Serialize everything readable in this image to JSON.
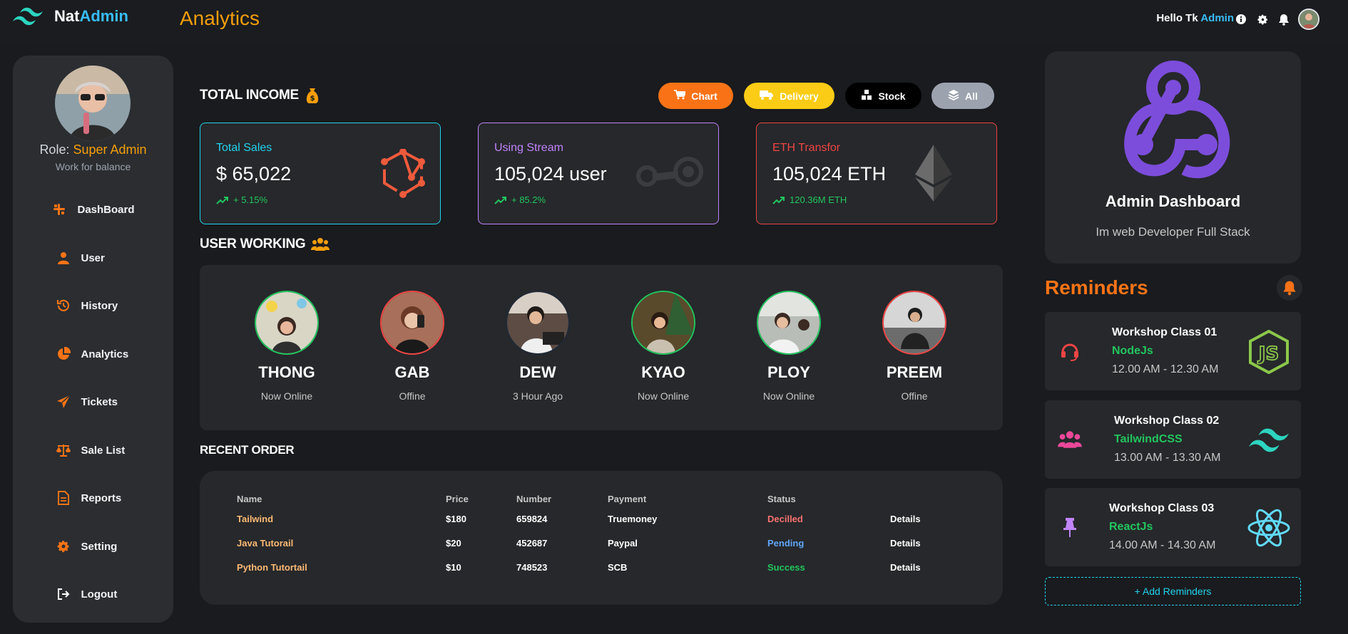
{
  "header": {
    "brand_part1": "Nat",
    "brand_part2": "Admin",
    "page_title": "Analytics",
    "greeting_prefix": "Hello Tk",
    "greeting_name": "Admin"
  },
  "sidebar": {
    "role_label": "Role:",
    "role_value": "Super Admin",
    "role_sub": "Work for balance",
    "items": [
      {
        "label": "DashBoard",
        "icon": "slack-icon"
      },
      {
        "label": "User",
        "icon": "user-icon"
      },
      {
        "label": "History",
        "icon": "history-icon"
      },
      {
        "label": "Analytics",
        "icon": "pie-chart-icon"
      },
      {
        "label": "Tickets",
        "icon": "paper-plane-icon"
      },
      {
        "label": "Sale List",
        "icon": "scale-icon"
      },
      {
        "label": "Reports",
        "icon": "file-icon"
      },
      {
        "label": "Setting",
        "icon": "gear-icon"
      },
      {
        "label": "Logout",
        "icon": "logout-icon"
      }
    ]
  },
  "income": {
    "title": "TOTAL INCOME",
    "buttons": {
      "chart": "Chart",
      "delivery": "Delivery",
      "stock": "Stock",
      "all": "All"
    },
    "cards": [
      {
        "title": "Total Sales",
        "value": "$ 65,022",
        "delta": "+ 5.15%",
        "color": "#22d3ee"
      },
      {
        "title": "Using Stream",
        "value": "105,024 user",
        "delta": "+ 85.2%",
        "color": "#c084fc"
      },
      {
        "title": "ETH Transfor",
        "value": "105,024 ETH",
        "delta": "120.36M ETH",
        "color": "#ef4444"
      }
    ]
  },
  "users": {
    "title": "USER WORKING",
    "list": [
      {
        "name": "THONG",
        "status": "Now Online"
      },
      {
        "name": "GAB",
        "status": "Offine"
      },
      {
        "name": "DEW",
        "status": "3 Hour Ago"
      },
      {
        "name": "KYAO",
        "status": "Now Online"
      },
      {
        "name": "PLOY",
        "status": "Now Online"
      },
      {
        "name": "PREEM",
        "status": "Offine"
      }
    ]
  },
  "orders": {
    "title": "RECENT ORDER",
    "headers": [
      "Name",
      "Price",
      "Number",
      "Payment",
      "Status"
    ],
    "rows": [
      {
        "name": "Tailwind",
        "price": "$180",
        "number": "659824",
        "payment": "Truemoney",
        "status": "Decilled",
        "action": "Details"
      },
      {
        "name": "Java Tutorail",
        "price": "$20",
        "number": "452687",
        "payment": "Paypal",
        "status": "Pending",
        "action": "Details"
      },
      {
        "name": "Python Tutortail",
        "price": "$10",
        "number": "748523",
        "payment": "SCB",
        "status": "Success",
        "action": "Details"
      }
    ]
  },
  "admin_card": {
    "title": "Admin Dashboard",
    "subtitle": "Im web Developer Full Stack"
  },
  "reminders": {
    "title": "Reminders",
    "items": [
      {
        "title": "Workshop Class 01",
        "subject": "NodeJs",
        "time": "12.00 AM - 12.30 AM"
      },
      {
        "title": "Workshop Class 02",
        "subject": "TailwindCSS",
        "time": "13.00 AM - 13.30 AM"
      },
      {
        "title": "Workshop Class 03",
        "subject": "ReactJs",
        "time": "14.00 AM - 14.30 AM"
      }
    ],
    "add_label": "+ Add Reminders"
  },
  "colors": {
    "accent_orange": "#f97316",
    "accent_amber": "#f59e0b",
    "accent_cyan": "#38bdf8",
    "success": "#22c55e",
    "danger": "#ef4444",
    "pending": "#60a5fa"
  }
}
